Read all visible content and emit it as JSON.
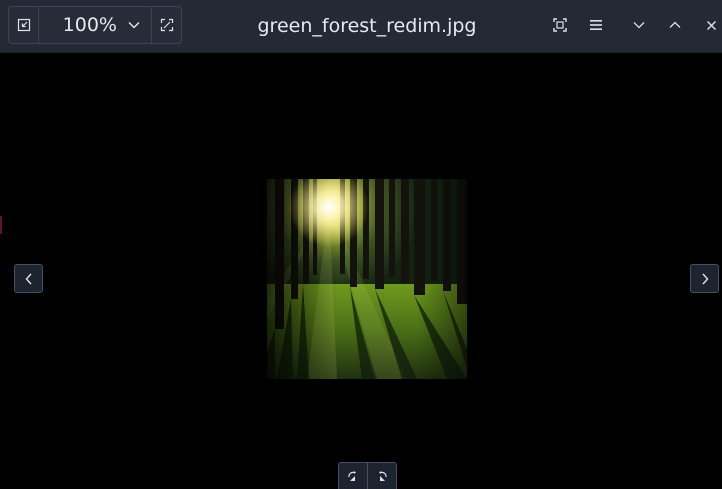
{
  "window": {
    "title": "green_forest_redim.jpg"
  },
  "toolbar": {
    "zoom_level": "100%",
    "icons": {
      "fit_window": "shrink-to-fit-icon",
      "zoom_menu": "chevron-down-icon",
      "fullscreen_toggle": "expand-icon",
      "fit_screen": "fit-screen-icon",
      "menu": "hamburger-menu-icon",
      "minimize": "chevron-down-icon",
      "maximize": "chevron-up-icon",
      "close": "close-icon"
    }
  },
  "navigation": {
    "previous": "chevron-left-icon",
    "next": "chevron-right-icon"
  },
  "rotate": {
    "left": "rotate-left-icon",
    "right": "rotate-right-icon"
  },
  "colors": {
    "titlebar_bg": "#232a35",
    "canvas_bg": "#000000",
    "text": "#e6e9ee",
    "button_border": "#465063"
  }
}
